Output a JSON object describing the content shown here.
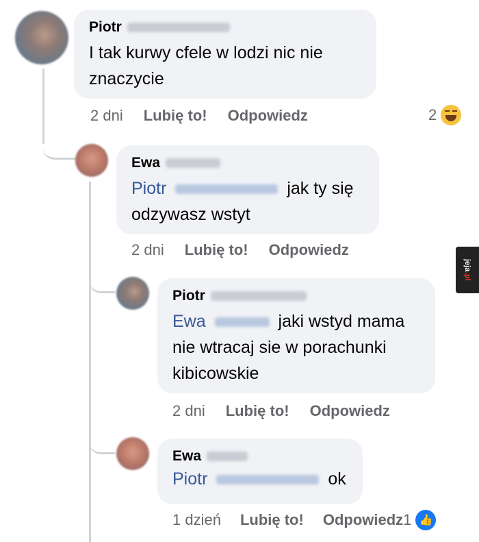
{
  "comments": [
    {
      "author": "Piotr",
      "mention": "",
      "text": "I tak kurwy cfele w lodzi nic nie znaczycie",
      "time": "2 dni",
      "like_label": "Lubię to!",
      "reply_label": "Odpowiedz",
      "reaction_count": "2",
      "reaction_icon": "laugh-emoji-icon"
    },
    {
      "author": "Ewa",
      "mention": "Piotr",
      "text": "jak ty się odzywasz wstyt",
      "time": "2 dni",
      "like_label": "Lubię to!",
      "reply_label": "Odpowiedz"
    },
    {
      "author": "Piotr",
      "mention": "Ewa",
      "text": "jaki wstyd mama nie wtracaj sie w porachunki kibicowskie",
      "time": "2 dni",
      "like_label": "Lubię to!",
      "reply_label": "Odpowiedz"
    },
    {
      "author": "Ewa",
      "mention": "Piotr",
      "text": "ok",
      "time": "1 dzień",
      "like_label": "Lubię to!",
      "reply_label": "Odpowiedz",
      "reaction_count": "1",
      "reaction_icon": "like-thumb-icon"
    }
  ],
  "watermark": {
    "main": "jeja",
    "suffix": ".pl"
  },
  "colors": {
    "bubble": "#f0f2f5",
    "mention": "#385898",
    "meta": "#65676b",
    "like": "#1877f2"
  }
}
